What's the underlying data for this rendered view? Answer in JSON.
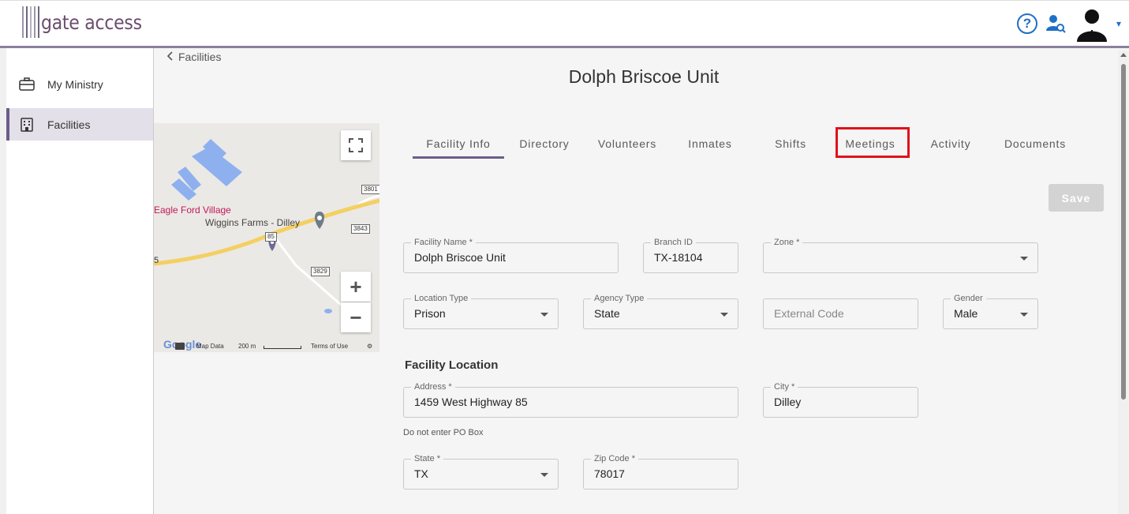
{
  "header": {
    "logo_text": "gate access",
    "help_icon": "help-circle-icon",
    "user_search_icon": "user-search-icon",
    "avatar_icon": "user-avatar",
    "caret": "▾",
    "accent": "#1f6fc5"
  },
  "sidebar": {
    "items": [
      {
        "label": "My Ministry",
        "icon": "briefcase-icon",
        "active": false
      },
      {
        "label": "Facilities",
        "icon": "building-icon",
        "active": true
      }
    ]
  },
  "breadcrumb": {
    "back_label": "Facilities"
  },
  "page": {
    "title": "Dolph Briscoe Unit"
  },
  "map": {
    "labels": {
      "village": "Eagle Ford Village",
      "farm": "Wiggins Farms - Dilley",
      "road_85": "85",
      "road_3801": "3801",
      "road_3843": "3843",
      "road_3829": "3829",
      "edge_5": "5"
    },
    "footer": {
      "google": "Google",
      "map_data": "Map Data",
      "scale": "200 m",
      "terms": "Terms of Use"
    },
    "zoom_in": "+",
    "zoom_out": "−"
  },
  "tabs": [
    {
      "label": "Facility Info",
      "active": true
    },
    {
      "label": "Directory"
    },
    {
      "label": "Volunteers"
    },
    {
      "label": "Inmates"
    },
    {
      "label": "Shifts"
    },
    {
      "label": "Meetings",
      "highlighted": true
    },
    {
      "label": "Activity"
    },
    {
      "label": "Documents"
    }
  ],
  "save_label": "Save",
  "form": {
    "facility_name": {
      "label": "Facility Name *",
      "value": "Dolph Briscoe Unit"
    },
    "branch_id": {
      "label": "Branch ID",
      "value": "TX-18104"
    },
    "zone": {
      "label": "Zone *",
      "value": ""
    },
    "location_type": {
      "label": "Location Type",
      "value": "Prison"
    },
    "agency_type": {
      "label": "Agency Type",
      "value": "State"
    },
    "external_code": {
      "placeholder": "External Code"
    },
    "gender": {
      "label": "Gender",
      "value": "Male"
    },
    "section_location": "Facility Location",
    "address": {
      "label": "Address *",
      "value": "1459 West Highway 85"
    },
    "address_helper": "Do not enter PO Box",
    "city": {
      "label": "City *",
      "value": "Dilley"
    },
    "state": {
      "label": "State *",
      "value": "TX"
    },
    "zip": {
      "label": "Zip Code *",
      "value": "78017"
    }
  }
}
